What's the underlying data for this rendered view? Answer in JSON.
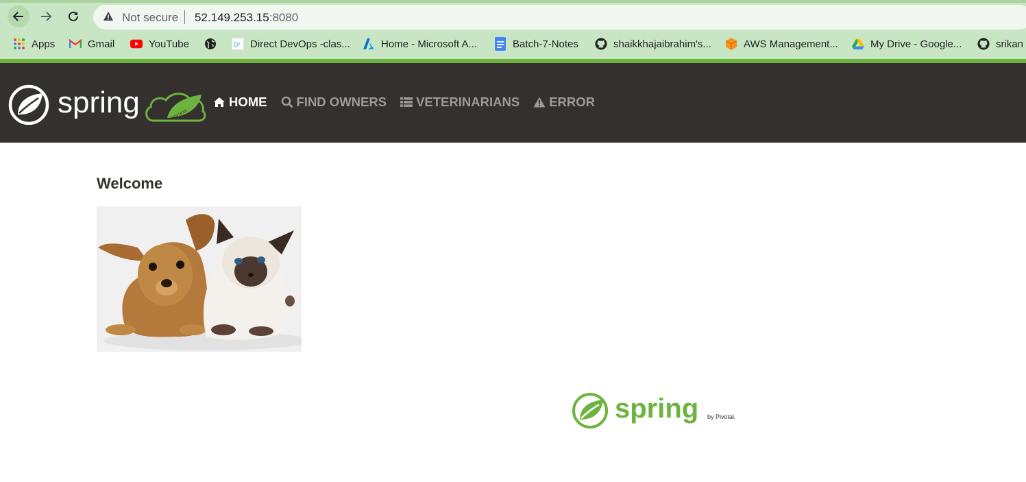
{
  "browser": {
    "security_label": "Not secure",
    "url_host": "52.149.253.15",
    "url_port": ":8080",
    "bookmarks": [
      {
        "label": "Apps",
        "icon": "apps-grid-icon"
      },
      {
        "label": "Gmail",
        "icon": "gmail-icon"
      },
      {
        "label": "YouTube",
        "icon": "youtube-icon"
      },
      {
        "label": "",
        "icon": "globe-icon"
      },
      {
        "label": "Direct DevOps -clas...",
        "icon": "d2-icon"
      },
      {
        "label": "Home - Microsoft A...",
        "icon": "azure-icon"
      },
      {
        "label": "Batch-7-Notes",
        "icon": "docs-icon"
      },
      {
        "label": "shaikkhajaibrahim's...",
        "icon": "github-icon"
      },
      {
        "label": "AWS Management...",
        "icon": "aws-cube-icon"
      },
      {
        "label": "My Drive - Google...",
        "icon": "drive-icon"
      },
      {
        "label": "srikan",
        "icon": "github-icon"
      }
    ]
  },
  "app": {
    "brand": "spring",
    "menu": [
      {
        "label": "Home",
        "icon": "home-icon",
        "active": true
      },
      {
        "label": "Find owners",
        "icon": "search-icon",
        "active": false
      },
      {
        "label": "Veterinarians",
        "icon": "list-icon",
        "active": false
      },
      {
        "label": "Error",
        "icon": "warning-icon",
        "active": false
      }
    ],
    "heading": "Welcome",
    "footer_brand": "spring",
    "footer_by": "by Pivotal."
  },
  "colors": {
    "nav_bg": "#34302d",
    "spring_green": "#6db33f",
    "chrome_green": "#c9e6c4"
  }
}
